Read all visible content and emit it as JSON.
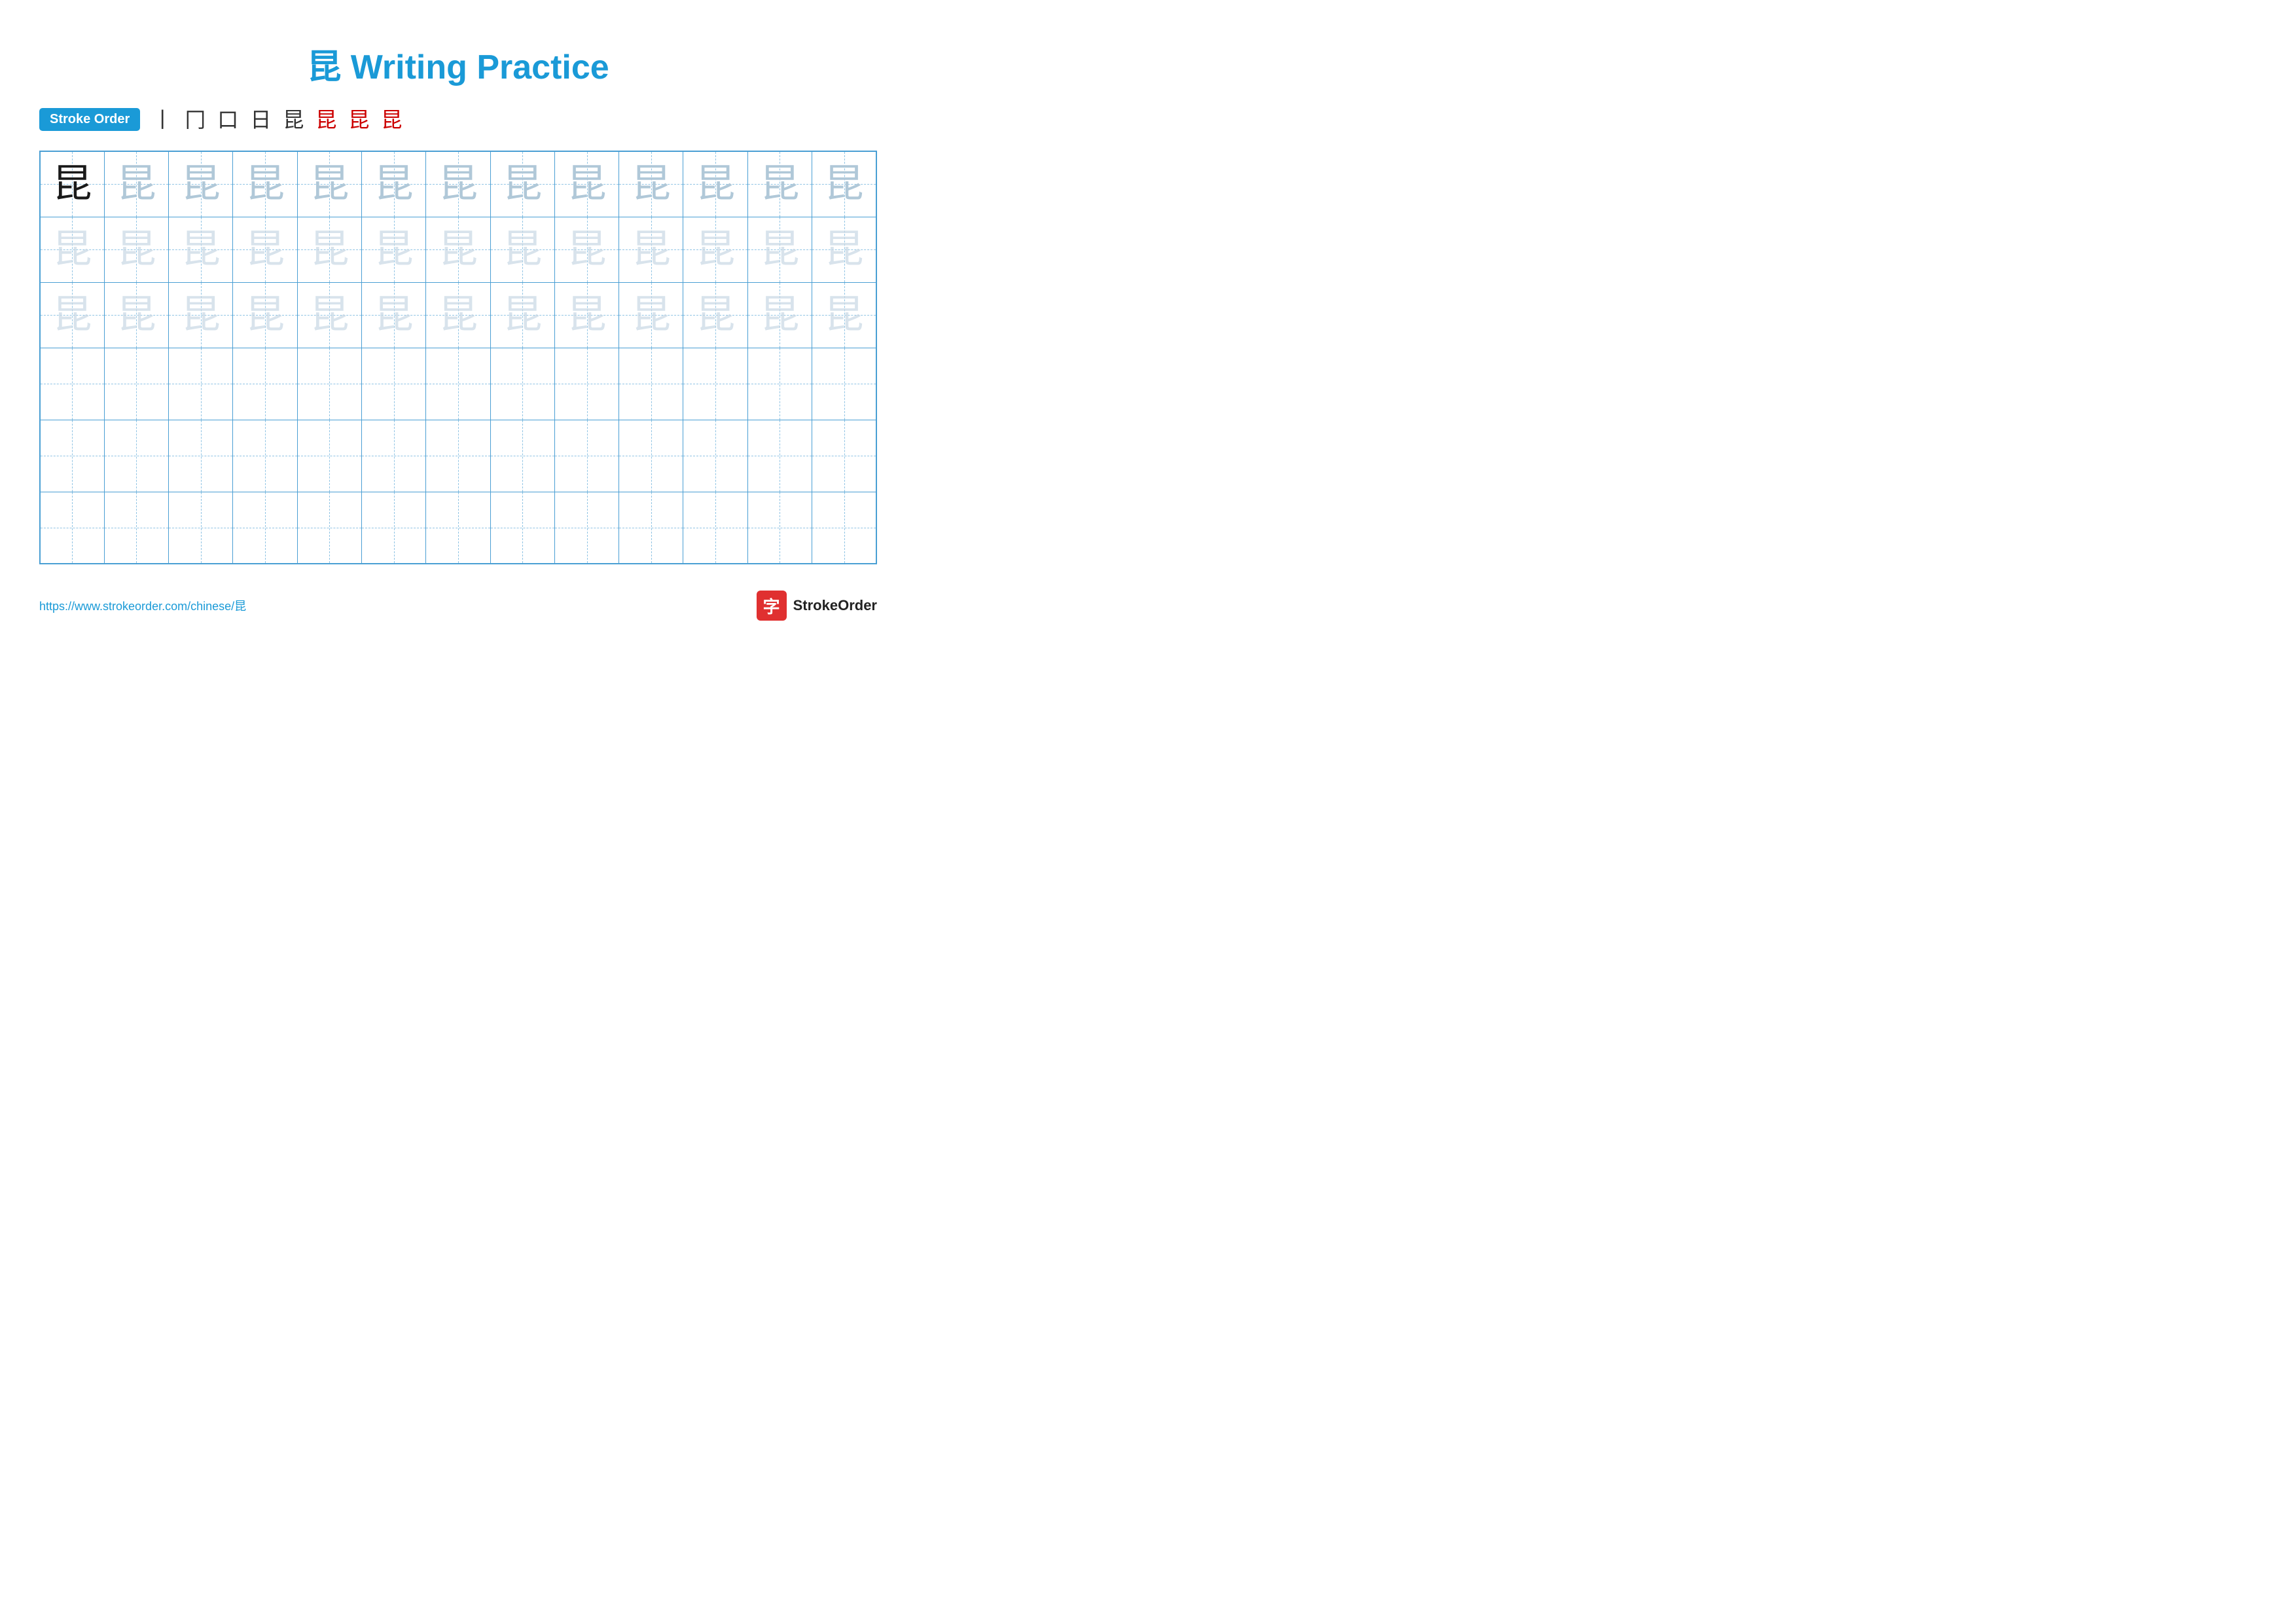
{
  "title": {
    "char": "昆",
    "subtitle": "Writing Practice",
    "full": "昆 Writing Practice"
  },
  "stroke_order": {
    "label": "Stroke Order",
    "steps": [
      "丨",
      "冂",
      "口",
      "日",
      "昆",
      "昆",
      "昆",
      "昆"
    ],
    "red_from": 5
  },
  "grid": {
    "rows": 6,
    "cols": 13,
    "character": "昆",
    "first_cell_dark": true,
    "guide_rows": 3,
    "empty_rows": 3
  },
  "footer": {
    "link": "https://www.strokeorder.com/chinese/昆",
    "logo_icon": "字",
    "logo_text": "StrokeOrder"
  }
}
